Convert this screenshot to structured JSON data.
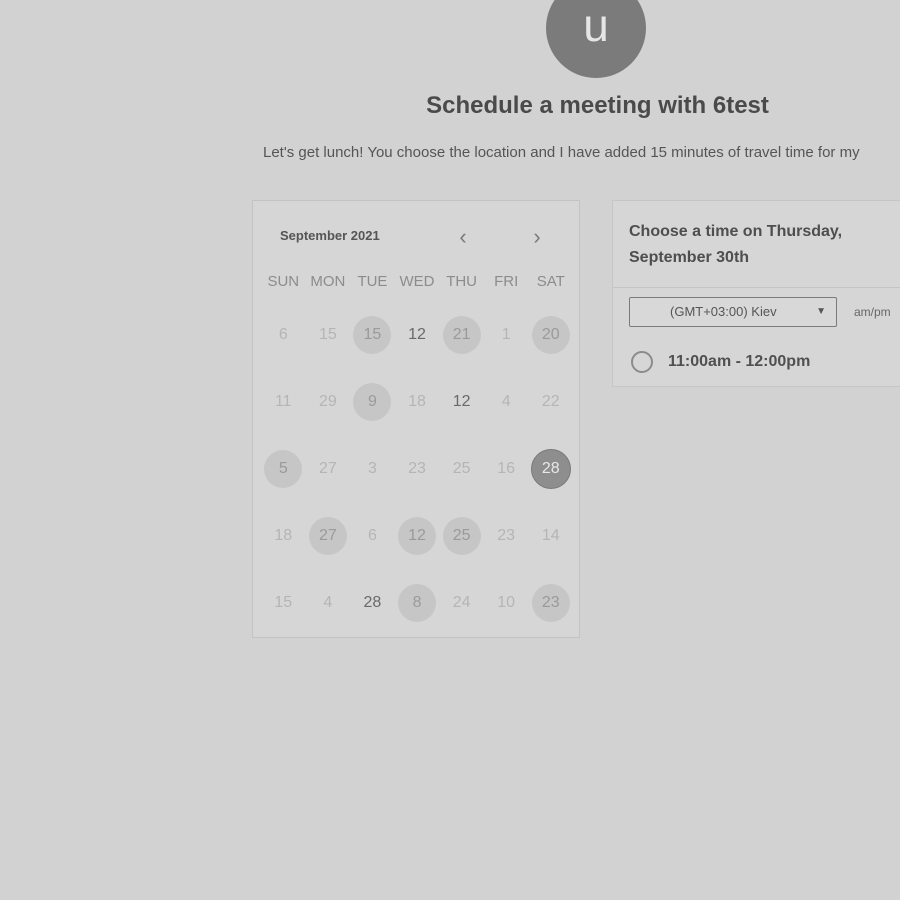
{
  "avatar": {
    "initial": "u"
  },
  "header": {
    "title": "Schedule a meeting with 6test",
    "subtitle": "Let's get lunch! You choose the location and I have added 15 minutes of travel time for my"
  },
  "calendar": {
    "month_label": "September 2021",
    "prev_icon": "chevron-left-icon",
    "next_icon": "chevron-right-icon",
    "weekdays": [
      "SUN",
      "MON",
      "TUE",
      "WED",
      "THU",
      "FRI",
      "SAT"
    ],
    "weeks": [
      [
        {
          "d": "6",
          "s": ""
        },
        {
          "d": "15",
          "s": ""
        },
        {
          "d": "15",
          "s": "avail"
        },
        {
          "d": "12",
          "s": "dark"
        },
        {
          "d": "21",
          "s": "avail"
        },
        {
          "d": "1",
          "s": ""
        },
        {
          "d": "20",
          "s": "avail"
        }
      ],
      [
        {
          "d": "11",
          "s": ""
        },
        {
          "d": "29",
          "s": ""
        },
        {
          "d": "9",
          "s": "avail"
        },
        {
          "d": "18",
          "s": ""
        },
        {
          "d": "12",
          "s": "dark"
        },
        {
          "d": "4",
          "s": ""
        },
        {
          "d": "22",
          "s": ""
        }
      ],
      [
        {
          "d": "5",
          "s": "avail"
        },
        {
          "d": "27",
          "s": ""
        },
        {
          "d": "3",
          "s": ""
        },
        {
          "d": "23",
          "s": ""
        },
        {
          "d": "25",
          "s": ""
        },
        {
          "d": "16",
          "s": ""
        },
        {
          "d": "28",
          "s": "selected"
        }
      ],
      [
        {
          "d": "18",
          "s": ""
        },
        {
          "d": "27",
          "s": "avail"
        },
        {
          "d": "6",
          "s": ""
        },
        {
          "d": "12",
          "s": "avail"
        },
        {
          "d": "25",
          "s": "avail"
        },
        {
          "d": "23",
          "s": ""
        },
        {
          "d": "14",
          "s": ""
        }
      ],
      [
        {
          "d": "15",
          "s": ""
        },
        {
          "d": "4",
          "s": ""
        },
        {
          "d": "28",
          "s": "dark"
        },
        {
          "d": "8",
          "s": "avail"
        },
        {
          "d": "24",
          "s": ""
        },
        {
          "d": "10",
          "s": ""
        },
        {
          "d": "23",
          "s": "avail"
        }
      ]
    ]
  },
  "times": {
    "heading": "Choose a time on Thursday, September 30th",
    "timezone": "(GMT+03:00) Kiev",
    "format_toggle": "am/pm",
    "slots": [
      {
        "label": "11:00am - 12:00pm"
      }
    ]
  },
  "colors": {
    "background": "#d2d2d2",
    "selected_day": "#8e8e8e",
    "available_day": "#c6c6c6"
  }
}
